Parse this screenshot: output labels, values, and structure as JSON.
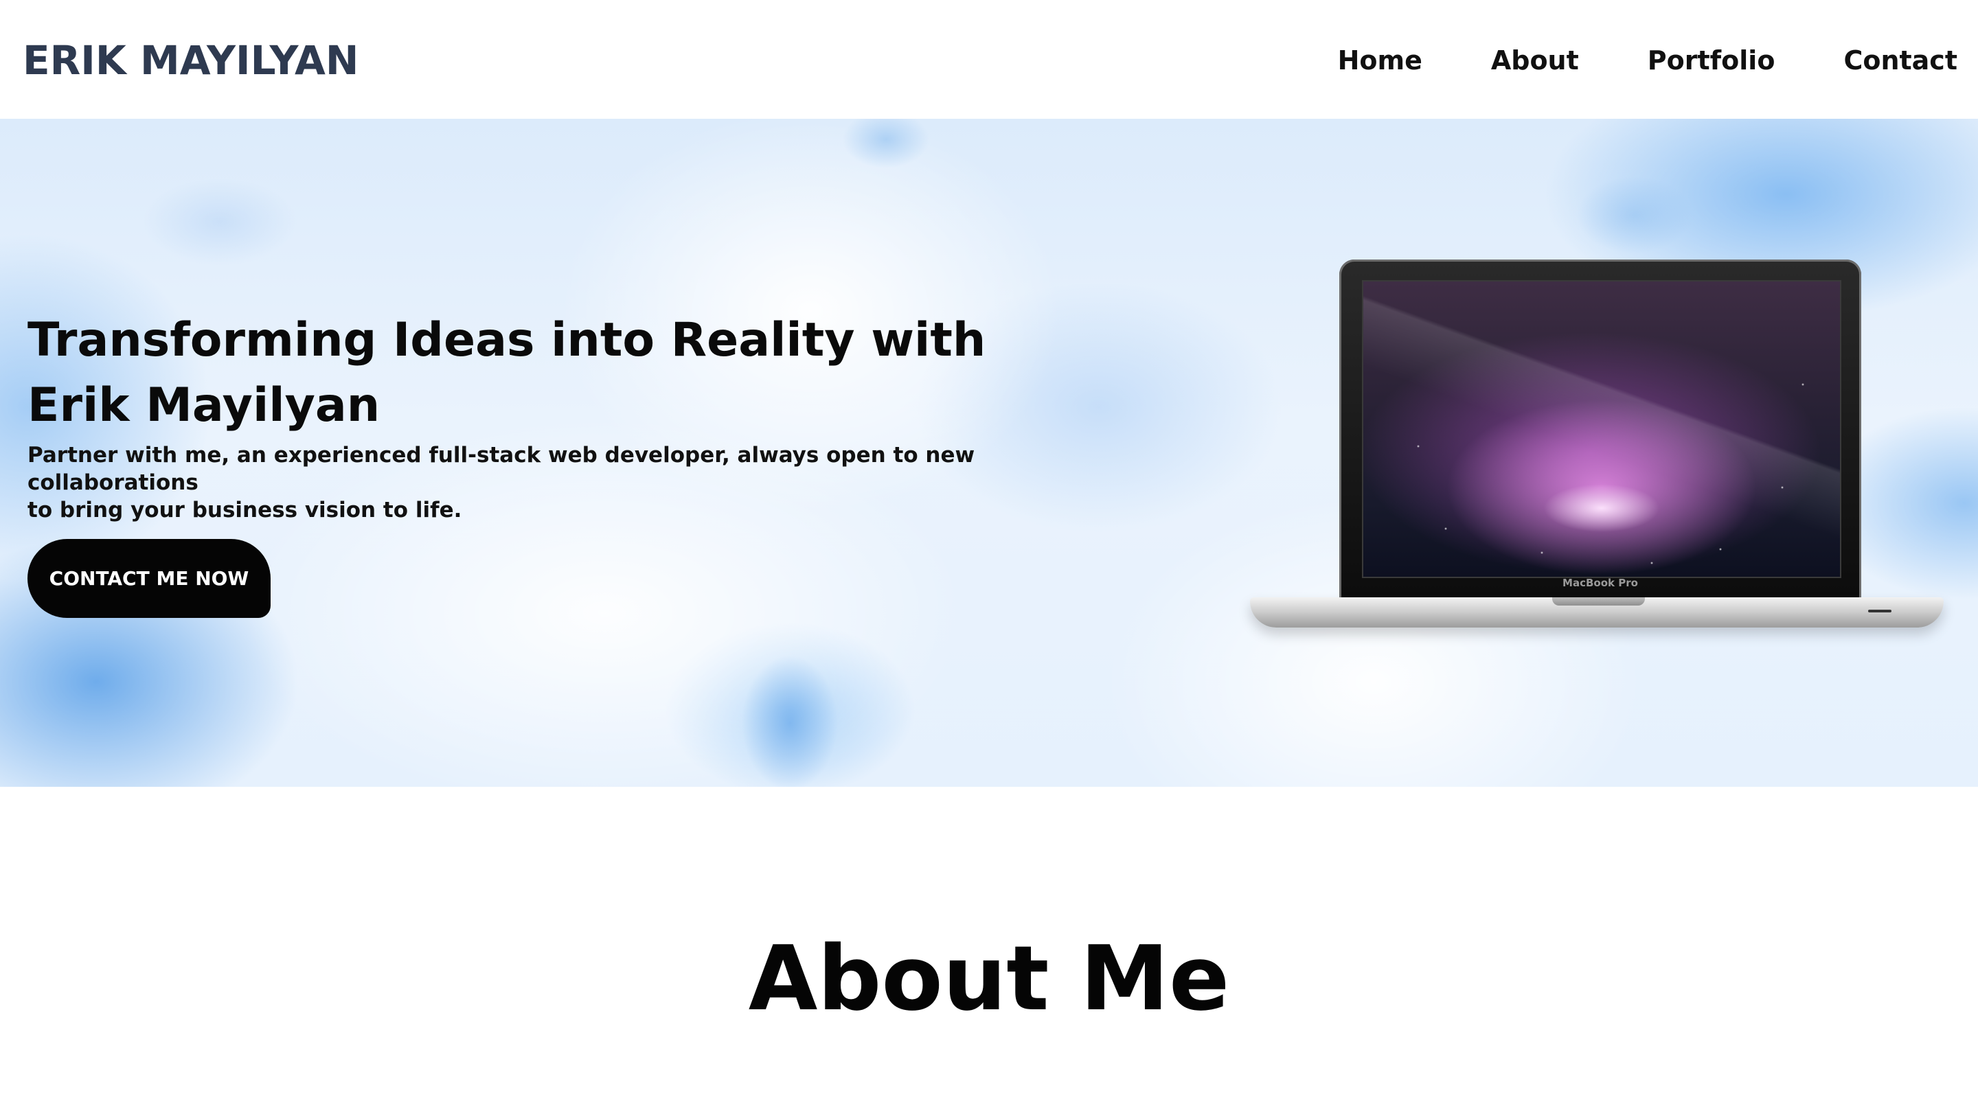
{
  "header": {
    "brand": "ERIK MAYILYAN",
    "nav": [
      {
        "label": "Home"
      },
      {
        "label": "About"
      },
      {
        "label": "Portfolio"
      },
      {
        "label": "Contact"
      }
    ]
  },
  "hero": {
    "title_line1": "Transforming Ideas into Reality with",
    "title_line2": "Erik Mayilyan",
    "subtitle_line1": "Partner with me, an experienced full-stack web developer, always open to new collaborations",
    "subtitle_line2": "to bring your business vision to life.",
    "cta_label": "CONTACT ME NOW",
    "laptop_label": "MacBook Pro"
  },
  "about": {
    "heading": "About Me"
  },
  "colors": {
    "brand_text": "#2e3a50",
    "cta_background": "#050505",
    "cta_text": "#ffffff",
    "hero_background": "#dcebfb"
  }
}
